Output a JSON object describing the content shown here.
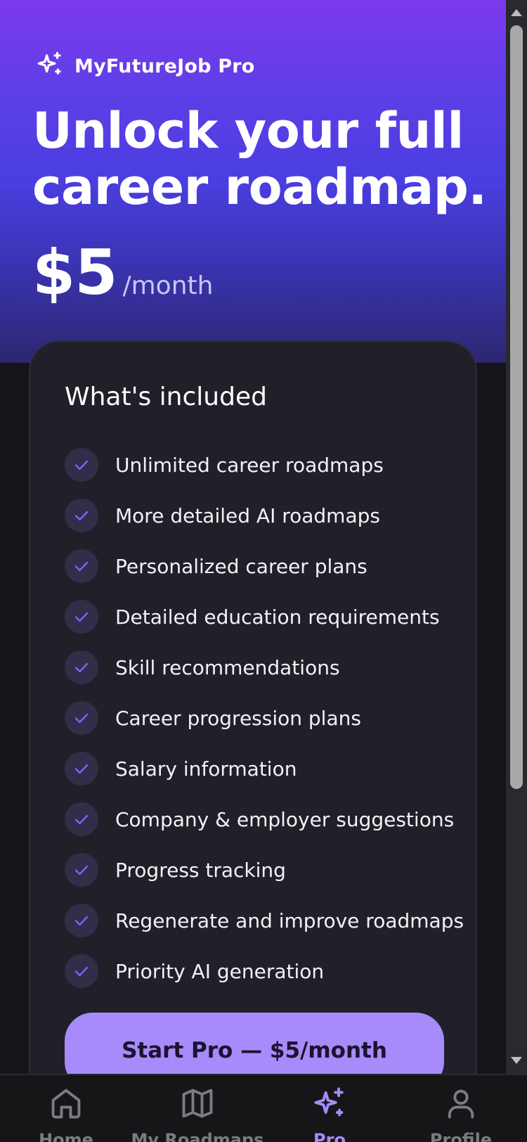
{
  "brand": {
    "name": "MyFutureJob Pro",
    "icon": "sparkles-icon"
  },
  "hero": {
    "headline": "Unlock your full career roadmap.",
    "price": "$5",
    "period": "/month"
  },
  "plan_card": {
    "title": "What's included",
    "features": [
      "Unlimited career roadmaps",
      "More detailed AI roadmaps",
      "Personalized career plans",
      "Detailed education requirements",
      "Skill recommendations",
      "Career progression plans",
      "Salary information",
      "Company & employer suggestions",
      "Progress tracking",
      "Regenerate and improve roadmaps",
      "Priority AI generation"
    ],
    "cta_label": "Start Pro — $5/month"
  },
  "tabbar": {
    "items": [
      {
        "label": "Home",
        "icon": "home-icon",
        "active": false
      },
      {
        "label": "My Roadmaps",
        "icon": "map-icon",
        "active": false
      },
      {
        "label": "Pro",
        "icon": "sparkles-icon",
        "active": true
      },
      {
        "label": "Profile",
        "icon": "user-icon",
        "active": false
      }
    ]
  },
  "colors": {
    "accent": "#a78bfa",
    "hero_top": "#7c3aed",
    "hero_mid": "#4a3ee0",
    "card_bg": "#212029",
    "page_bg": "#141419",
    "check_bg": "#322d48"
  }
}
